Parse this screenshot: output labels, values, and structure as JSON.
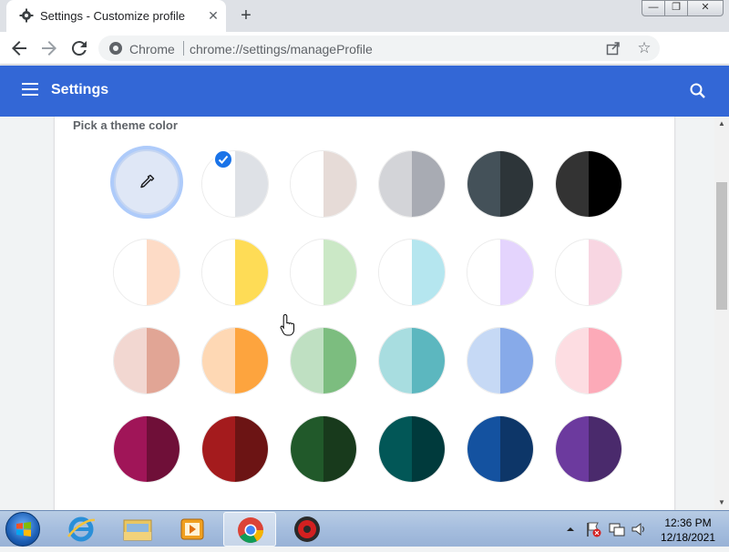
{
  "window": {
    "tab_title": "Settings - Customize profile",
    "tab_close": "✕",
    "new_tab": "+",
    "controls": {
      "minimize": "—",
      "maximize": "❐",
      "close": "✕"
    }
  },
  "toolbar": {
    "omnibox_origin": "Chrome",
    "url_scheme_host": "chrome://settings/",
    "url_path": "manageProfile",
    "star": "☆"
  },
  "settings": {
    "title": "Settings",
    "section_title": "Pick a theme color"
  },
  "theme_colors": {
    "rows": [
      [
        {
          "name": "custom",
          "left": "#dfe7f6",
          "right": "#c4d5f2",
          "selected": true
        },
        {
          "name": "light-grey",
          "left": "#ffffff",
          "right": "#dee1e6"
        },
        {
          "name": "light-beige",
          "left": "#ffffff",
          "right": "#e6dbd7"
        },
        {
          "name": "grey",
          "left": "#d3d4d8",
          "right": "#a8abb3"
        },
        {
          "name": "dark-slate",
          "left": "#445159",
          "right": "#2d3539"
        },
        {
          "name": "black",
          "left": "#333333",
          "right": "#000000"
        }
      ],
      [
        {
          "name": "peach-light",
          "left": "#ffffff",
          "right": "#fddbc6"
        },
        {
          "name": "yellow",
          "left": "#ffffff",
          "right": "#fedc56"
        },
        {
          "name": "green-light",
          "left": "#ffffff",
          "right": "#cbe8c6"
        },
        {
          "name": "cyan-light",
          "left": "#ffffff",
          "right": "#b5e6ef"
        },
        {
          "name": "lavender-light",
          "left": "#ffffff",
          "right": "#e4d4fd"
        },
        {
          "name": "pink-light",
          "left": "#ffffff",
          "right": "#f8d6e2"
        }
      ],
      [
        {
          "name": "rose",
          "left": "#f2d7d1",
          "right": "#e1a595"
        },
        {
          "name": "orange",
          "left": "#fed8b4",
          "right": "#fda43e"
        },
        {
          "name": "green",
          "left": "#bfe0c2",
          "right": "#7cbd7f"
        },
        {
          "name": "teal",
          "left": "#a8dde0",
          "right": "#5cb7bf"
        },
        {
          "name": "blue",
          "left": "#c6d9f5",
          "right": "#87aae9"
        },
        {
          "name": "pink",
          "left": "#fddde2",
          "right": "#fcaab8"
        }
      ],
      [
        {
          "name": "magenta",
          "left": "#a01558",
          "right": "#6f0f38"
        },
        {
          "name": "red",
          "left": "#a41b1d",
          "right": "#6c1414"
        },
        {
          "name": "dark-green",
          "left": "#21592a",
          "right": "#183a1c"
        },
        {
          "name": "dark-teal",
          "left": "#025757",
          "right": "#003a3c"
        },
        {
          "name": "navy",
          "left": "#1452a0",
          "right": "#0d3668"
        },
        {
          "name": "purple",
          "left": "#6c3a9e",
          "right": "#4a2a6c"
        }
      ]
    ]
  },
  "taskbar": {
    "clock_time": "12:36 PM",
    "clock_date": "12/18/2021"
  }
}
